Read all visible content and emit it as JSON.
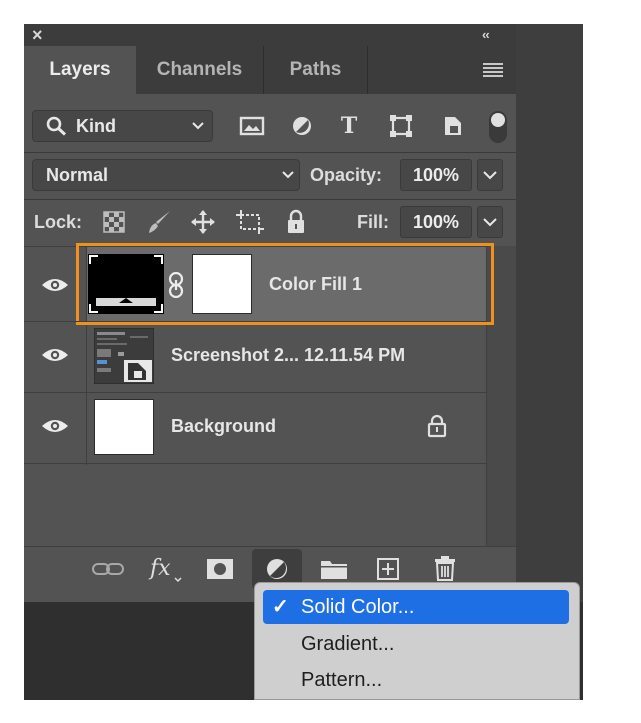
{
  "panel": {
    "close_glyph": "×",
    "collapse_glyph": "‹‹",
    "tabs": [
      {
        "label": "Layers",
        "active": true
      },
      {
        "label": "Channels",
        "active": false
      },
      {
        "label": "Paths",
        "active": false
      }
    ]
  },
  "filter": {
    "kind_label": "Kind",
    "icons": [
      "image-filter-icon",
      "adjustment-filter-icon",
      "type-filter-icon",
      "shape-filter-icon",
      "smart-object-filter-icon",
      "filter-toggle-icon"
    ]
  },
  "blend": {
    "mode": "Normal",
    "opacity_label": "Opacity:",
    "opacity_value": "100%"
  },
  "lock": {
    "label": "Lock:",
    "fill_label": "Fill:",
    "fill_value": "100%"
  },
  "layers": [
    {
      "name": "Color Fill 1",
      "visible": true,
      "selected": true,
      "type": "fill"
    },
    {
      "name": "Screenshot 2... 12.11.54 PM",
      "visible": true,
      "selected": false,
      "type": "smart-object"
    },
    {
      "name": "Background",
      "visible": true,
      "selected": false,
      "type": "background",
      "locked": true
    }
  ],
  "bottom_bar": {
    "fx_label": "fx"
  },
  "menu": {
    "items": [
      {
        "label": "Solid Color...",
        "checked": true,
        "check": "✓"
      },
      {
        "label": "Gradient...",
        "checked": false
      },
      {
        "label": "Pattern...",
        "checked": false
      }
    ]
  },
  "colors": {
    "highlight_border": "#f0901e",
    "menu_selection": "#1d6fe3",
    "panel_bg": "#535353"
  }
}
